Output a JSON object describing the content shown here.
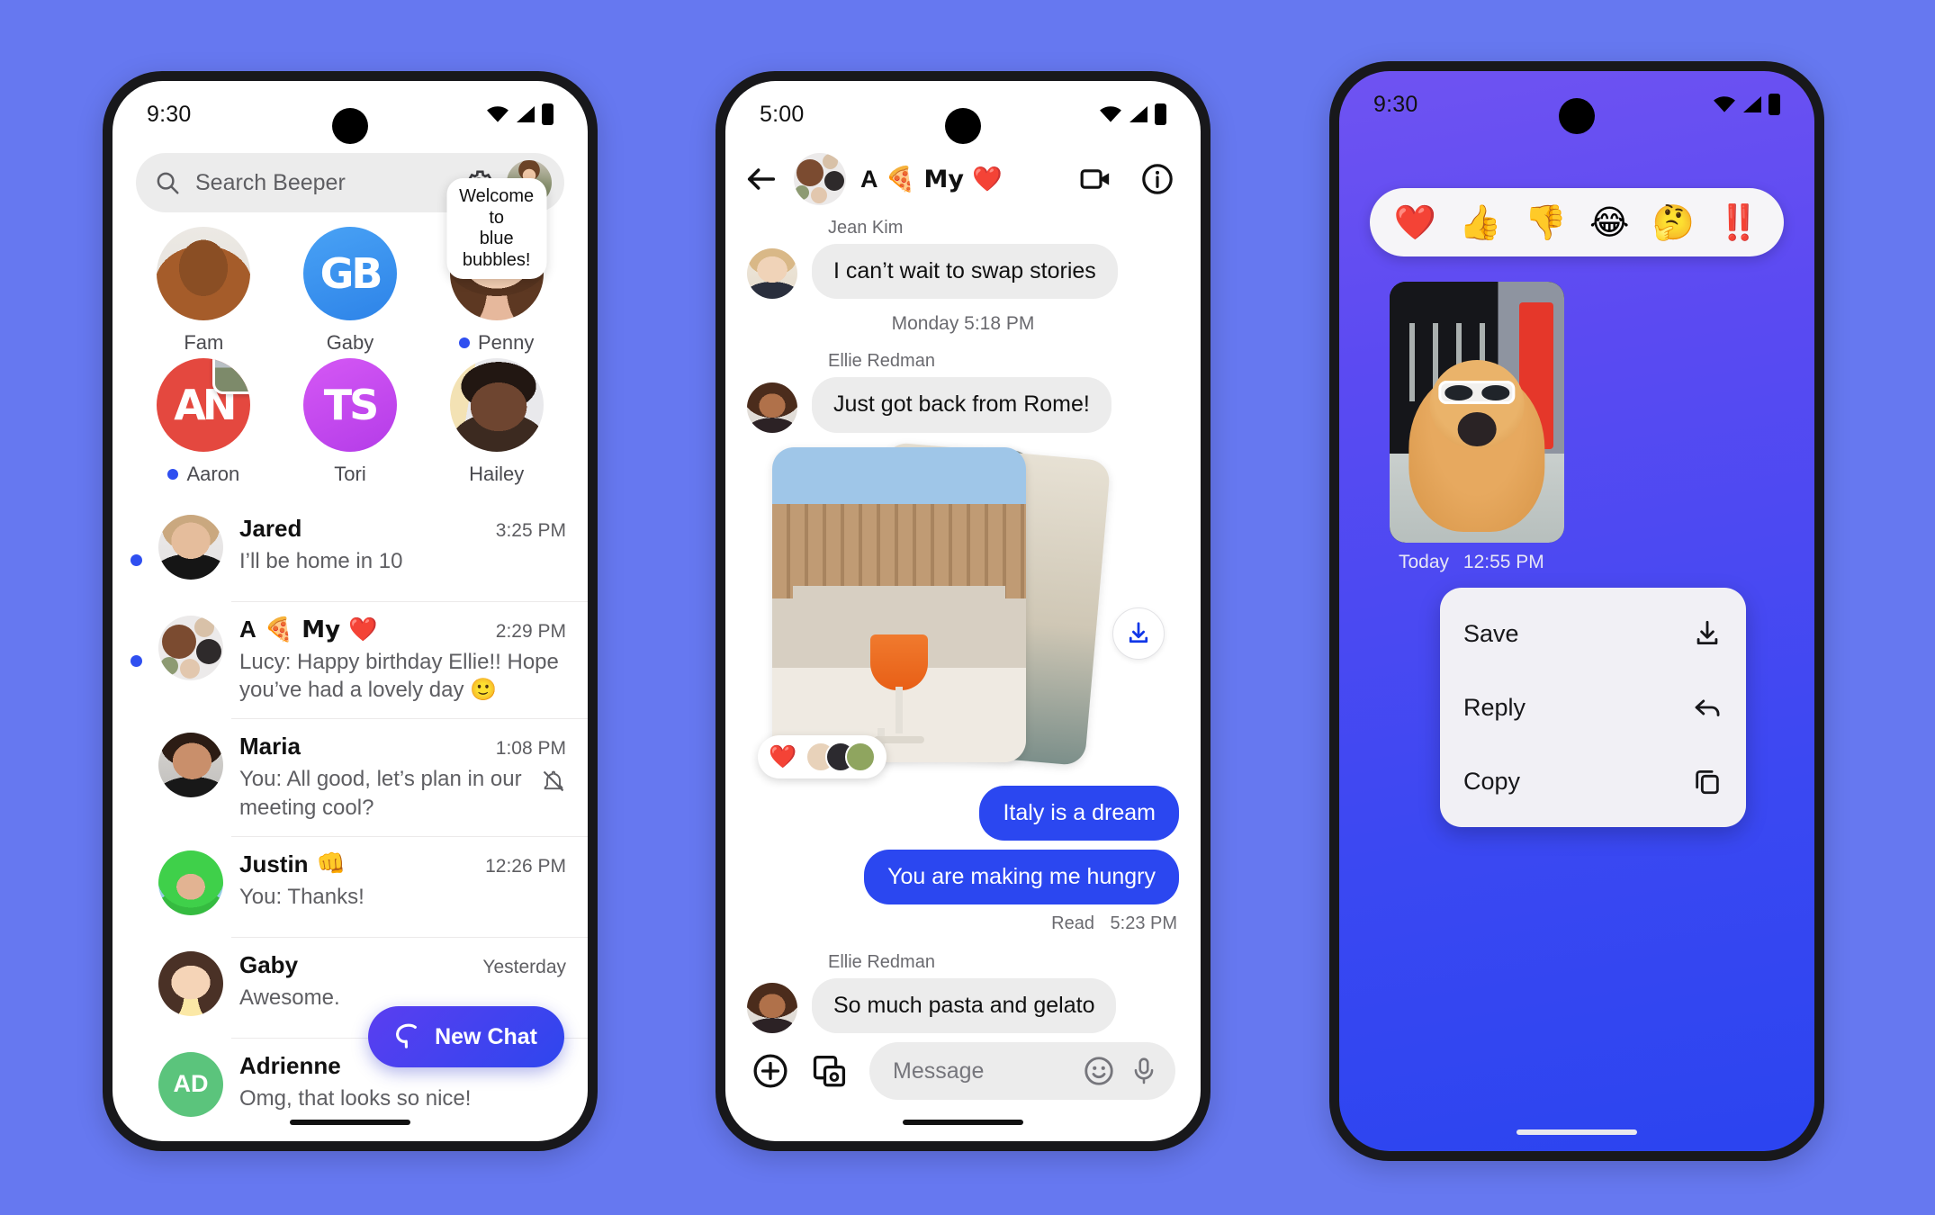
{
  "app": {
    "name": "Beeper",
    "accent": "#2b47f0",
    "background": "#6678f0"
  },
  "phone1": {
    "status": {
      "time": "9:30",
      "wifi": "wifi-icon",
      "signal": "cellular-icon",
      "battery": "battery-icon"
    },
    "search": {
      "placeholder": "Search Beeper",
      "icon": "search-icon",
      "settings_icon": "gear-icon",
      "profile": "profile-avatar"
    },
    "tooltip": {
      "text": "Welcome to\nblue bubbles!"
    },
    "favorites": [
      {
        "name": "Fam",
        "unread": false,
        "avatar": "dog-photo-avatar"
      },
      {
        "name": "Gaby",
        "unread": false,
        "avatar": "gb-logo-avatar",
        "initials": "GB"
      },
      {
        "name": "Penny",
        "unread": true,
        "avatar": "penny-photo-avatar",
        "tooltip": true
      },
      {
        "name": "Aaron",
        "unread": true,
        "avatar": "an-logo-avatar",
        "initials": "AN",
        "badge": "photo-badge"
      },
      {
        "name": "Tori",
        "unread": false,
        "avatar": "ts-logo-avatar",
        "initials": "TS"
      },
      {
        "name": "Hailey",
        "unread": false,
        "avatar": "hailey-photo-avatar"
      }
    ],
    "chats": [
      {
        "name": "Jared",
        "emoji": "",
        "time": "3:25 PM",
        "preview": "I’ll be home in 10",
        "unread": true,
        "muted": false,
        "avatar": "jared-avatar"
      },
      {
        "name": "A",
        "emoji": "🍕 My ❤️",
        "time": "2:29 PM",
        "preview": "Lucy: Happy birthday Ellie!! Hope you’ve had a lovely day  🙂",
        "unread": true,
        "muted": false,
        "avatar": "group-avatar"
      },
      {
        "name": "Maria",
        "emoji": "",
        "time": "1:08 PM",
        "preview": "You: All good, let’s plan in our meeting cool?",
        "unread": false,
        "muted": true,
        "avatar": "maria-avatar"
      },
      {
        "name": "Justin",
        "emoji": "👊",
        "time": "12:26 PM",
        "preview": "You: Thanks!",
        "unread": false,
        "muted": false,
        "avatar": "justin-avatar"
      },
      {
        "name": "Gaby",
        "emoji": "",
        "time": "Yesterday",
        "preview": "Awesome.",
        "unread": false,
        "muted": false,
        "avatar": "gaby-memoji-avatar"
      },
      {
        "name": "Adrienne",
        "emoji": "",
        "time": "",
        "preview": "Omg, that looks so nice!",
        "unread": false,
        "muted": false,
        "avatar": "initials-avatar",
        "initials": "AD"
      }
    ],
    "fab": {
      "label": "New Chat",
      "icon": "chat-bubble-icon"
    }
  },
  "phone2": {
    "status": {
      "time": "5:00"
    },
    "header": {
      "back_icon": "back-arrow-icon",
      "title": "A",
      "title_suffix": "🍕 My ❤️",
      "avatar": "group-avatar",
      "video_icon": "video-call-icon",
      "info_icon": "info-icon"
    },
    "messages": [
      {
        "kind": "incoming",
        "sender": "Jean Kim",
        "text": "I can’t wait to swap stories",
        "avatar": "jean-kim-avatar"
      },
      {
        "kind": "divider",
        "text": "Monday 5:18 PM"
      },
      {
        "kind": "incoming",
        "sender": "Ellie Redman",
        "text": "Just got back from Rome!",
        "avatar": "ellie-redman-avatar"
      },
      {
        "kind": "photo-stack",
        "download_icon": "download-icon",
        "reaction": "❤️",
        "reactor_count": 3
      },
      {
        "kind": "outgoing",
        "text": "Italy is a dream"
      },
      {
        "kind": "outgoing",
        "text": "You are making me hungry"
      },
      {
        "kind": "receipt",
        "status": "Read",
        "time": "5:23 PM"
      },
      {
        "kind": "incoming",
        "sender": "Ellie Redman",
        "text": "So much pasta and gelato",
        "avatar": "ellie-redman-avatar"
      }
    ],
    "composer": {
      "plus_icon": "add-attachment-icon",
      "gallery_icon": "gallery-icon",
      "placeholder": "Message",
      "emoji_icon": "emoji-icon",
      "mic_icon": "microphone-icon"
    }
  },
  "phone3": {
    "status": {
      "time": "9:30"
    },
    "reactions": [
      "❤️",
      "👍",
      "👎",
      "😂",
      "🤔",
      "‼️"
    ],
    "photo": {
      "alt": "dog-with-sunglasses-photo"
    },
    "photo_timestamp": {
      "day": "Today",
      "time": "12:55 PM"
    },
    "menu": [
      {
        "label": "Save",
        "icon": "download-icon"
      },
      {
        "label": "Reply",
        "icon": "reply-arrow-icon"
      },
      {
        "label": "Copy",
        "icon": "copy-icon"
      }
    ]
  }
}
